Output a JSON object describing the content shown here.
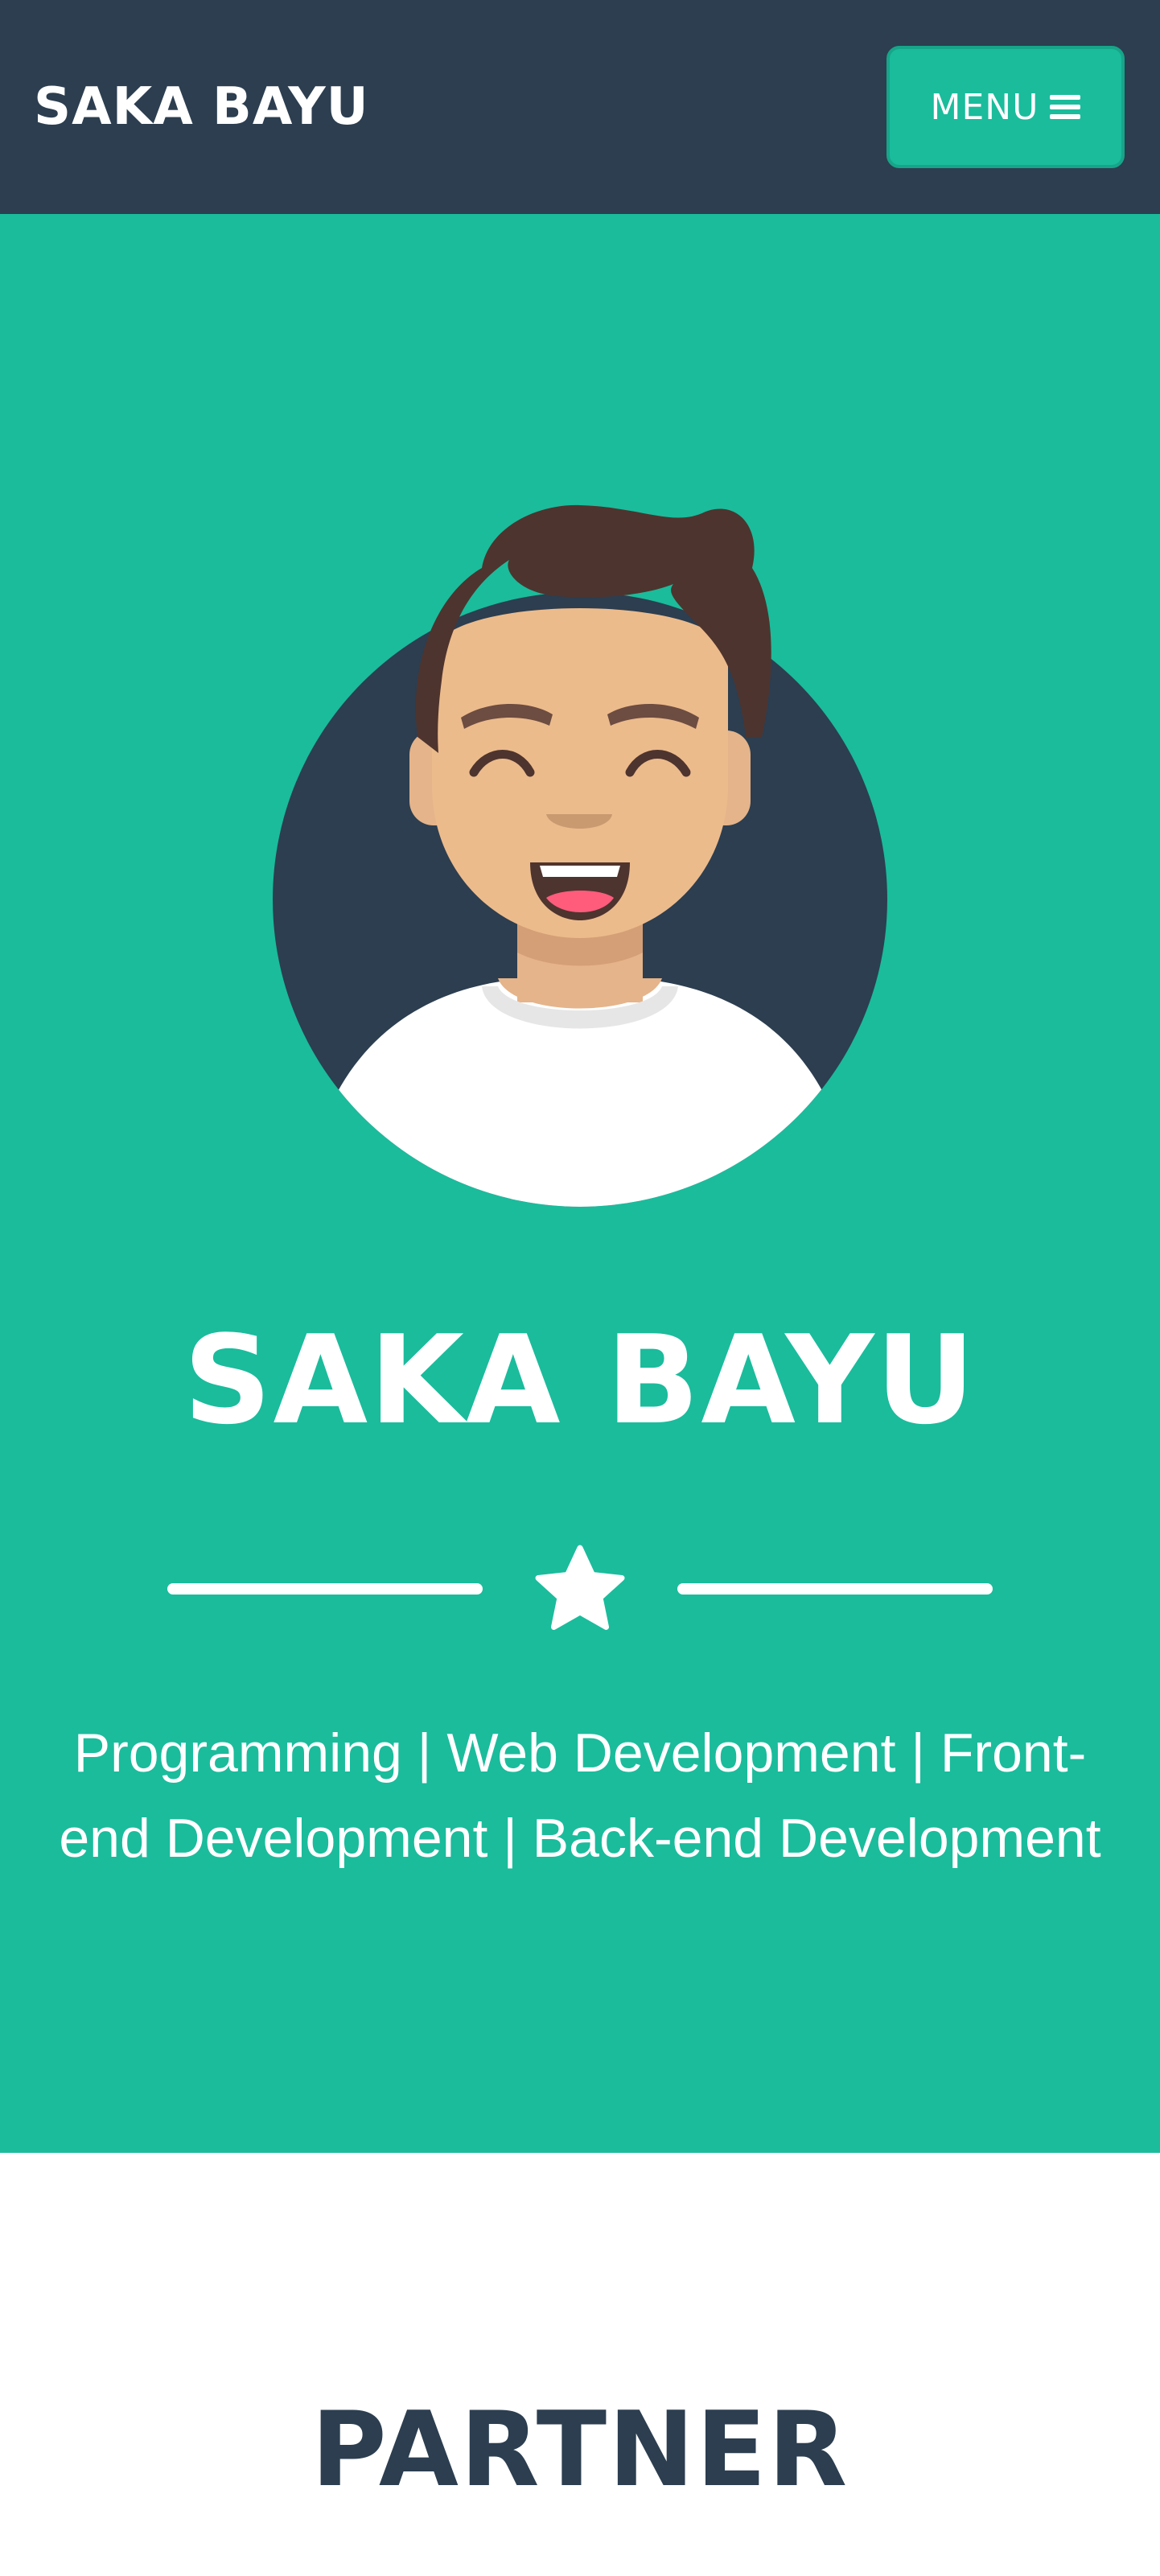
{
  "navbar": {
    "brand": "SAKA BAYU",
    "menu_label": "MENU",
    "menu_icon": "hamburger-icon"
  },
  "masthead": {
    "avatar_icon": "avatar-illustration",
    "title": "SAKA BAYU",
    "divider_icon": "star-icon",
    "subtitle": "Programming | Web Development | Front-end Development | Back-end Development"
  },
  "partner": {
    "heading": "PARTNER"
  },
  "colors": {
    "navbar_bg": "#2c3e50",
    "primary": "#1abc9c",
    "heading_dark": "#2c3e50",
    "white": "#ffffff"
  }
}
